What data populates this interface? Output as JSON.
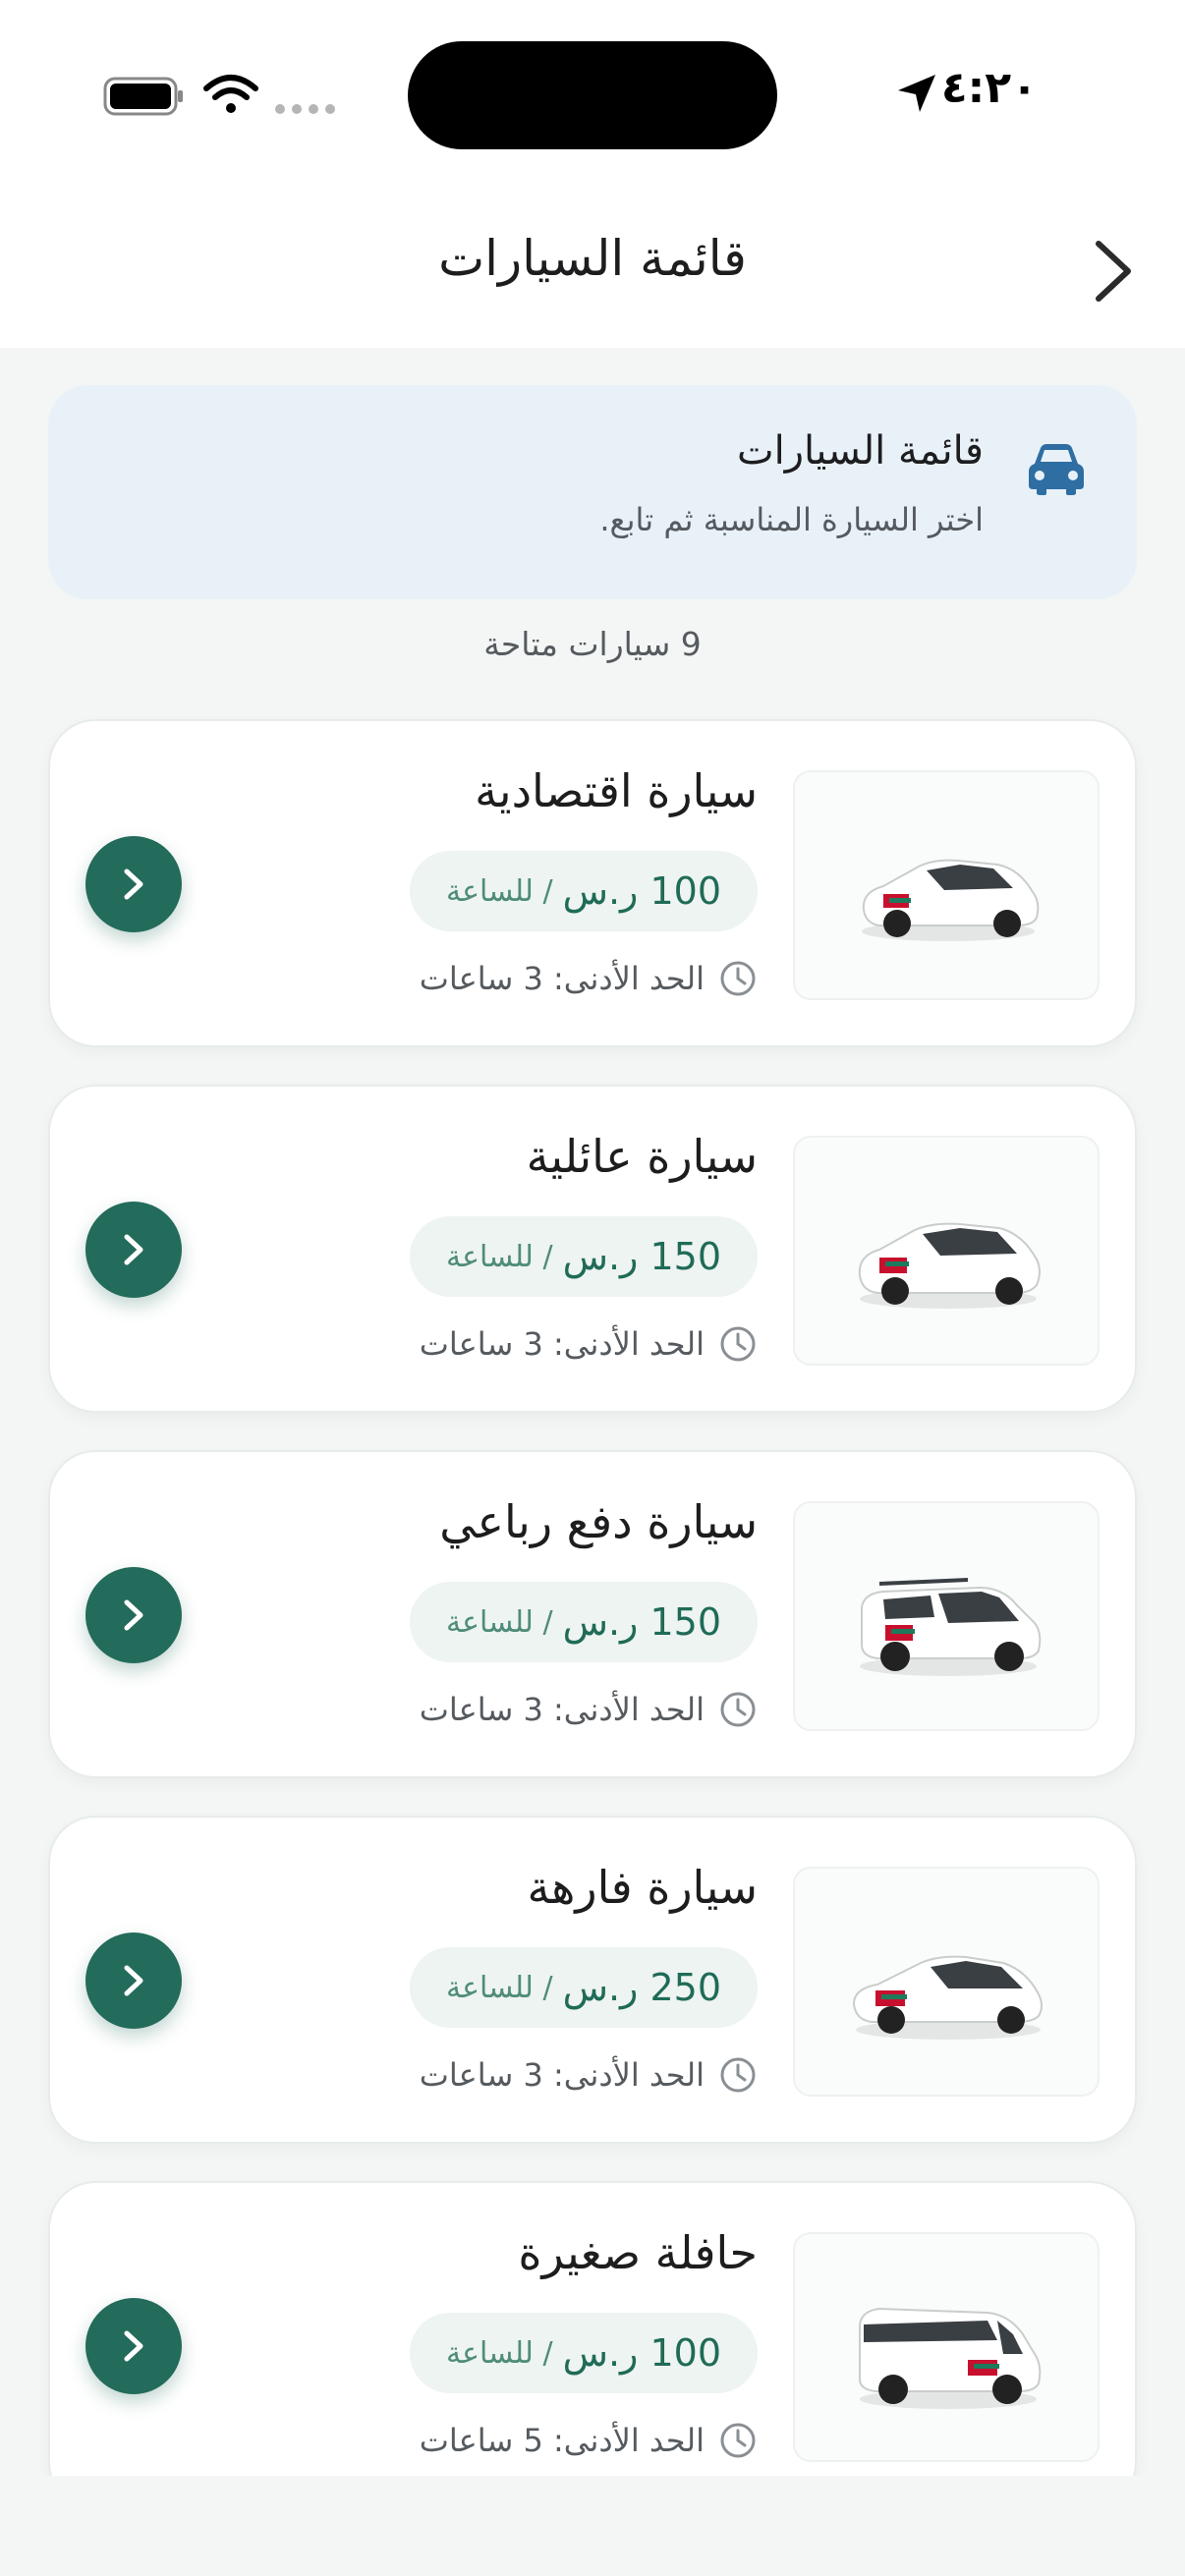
{
  "status_bar": {
    "time": "٤:٢٠"
  },
  "header": {
    "title": "قائمة السيارات"
  },
  "banner": {
    "title": "قائمة السيارات",
    "subtitle": "اختر السيارة المناسبة ثم تابع.",
    "icon": "car-icon"
  },
  "count_text": "9 سيارات متاحة",
  "cars": [
    {
      "title": "سيارة اقتصادية",
      "price": "100 ر.س",
      "unit": "/ للساعة",
      "min": "الحد الأدنى: 3 ساعات",
      "type": "sedan"
    },
    {
      "title": "سيارة عائلية",
      "price": "150 ر.س",
      "unit": "/ للساعة",
      "min": "الحد الأدنى: 3 ساعات",
      "type": "family"
    },
    {
      "title": "سيارة دفع رباعي",
      "price": "150 ر.س",
      "unit": "/ للساعة",
      "min": "الحد الأدنى: 3 ساعات",
      "type": "suv"
    },
    {
      "title": "سيارة فارهة",
      "price": "250 ر.س",
      "unit": "/ للساعة",
      "min": "الحد الأدنى: 3 ساعات",
      "type": "luxury"
    },
    {
      "title": "حافلة صغيرة",
      "price": "100 ر.س",
      "unit": "/ للساعة",
      "min": "الحد الأدنى: 5 ساعات",
      "type": "minibus"
    }
  ],
  "colors": {
    "accent": "#236b5b",
    "banner_bg": "#e9f1f8",
    "banner_icon": "#2f6ea3"
  }
}
